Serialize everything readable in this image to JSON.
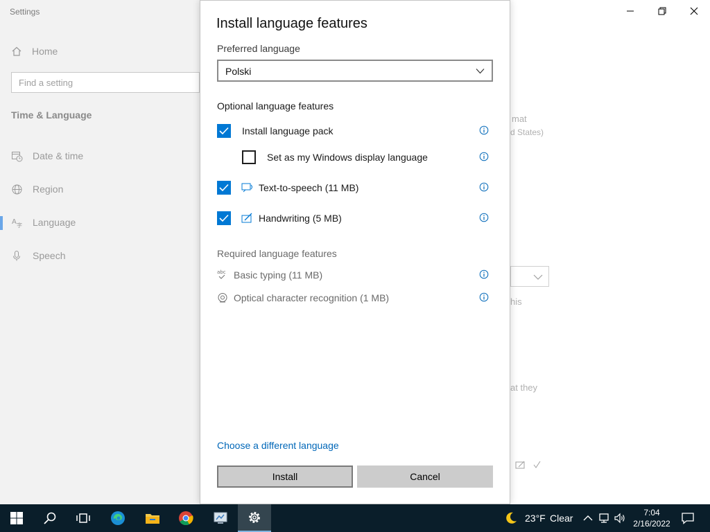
{
  "window": {
    "app_title": "Settings",
    "controls": [
      "minimize-icon",
      "restore-icon",
      "close-icon"
    ]
  },
  "sidebar": {
    "home_label": "Home",
    "search_placeholder": "Find a setting",
    "section_title": "Time & Language",
    "items": [
      {
        "label": "Date & time",
        "icon": "calendar-clock-icon"
      },
      {
        "label": "Region",
        "icon": "globe-icon"
      },
      {
        "label": "Language",
        "icon": "language-icon",
        "active": true
      },
      {
        "label": "Speech",
        "icon": "microphone-icon"
      }
    ]
  },
  "behind_content": {
    "fragment_1": "mat",
    "fragment_2": "d States)",
    "fragment_3": "his",
    "fragment_4": "at they"
  },
  "dialog": {
    "title": "Install language features",
    "preferred_label": "Preferred language",
    "preferred_value": "Polski",
    "optional_heading": "Optional language features",
    "optional_features": [
      {
        "label": "Install language pack",
        "checked": true,
        "icon": "none"
      },
      {
        "label": "Set as my Windows display language",
        "checked": false,
        "icon": "none"
      },
      {
        "label": "Text-to-speech (11 MB)",
        "checked": true,
        "icon": "speech-icon"
      },
      {
        "label": "Handwriting (5 MB)",
        "checked": true,
        "icon": "handwriting-icon"
      }
    ],
    "required_heading": "Required language features",
    "required_features": [
      {
        "label": "Basic typing (11 MB)",
        "icon": "abc-check-icon"
      },
      {
        "label": "Optical character recognition (1 MB)",
        "icon": "ocr-icon"
      }
    ],
    "link": "Choose a different language",
    "install_label": "Install",
    "cancel_label": "Cancel"
  },
  "taskbar": {
    "weather_temp": "23°F",
    "weather_text": "Clear",
    "time": "7:04",
    "date": "2/16/2022"
  },
  "colors": {
    "accent": "#0078d4",
    "link": "#0067b8",
    "taskbar": "#0a1e2a"
  }
}
